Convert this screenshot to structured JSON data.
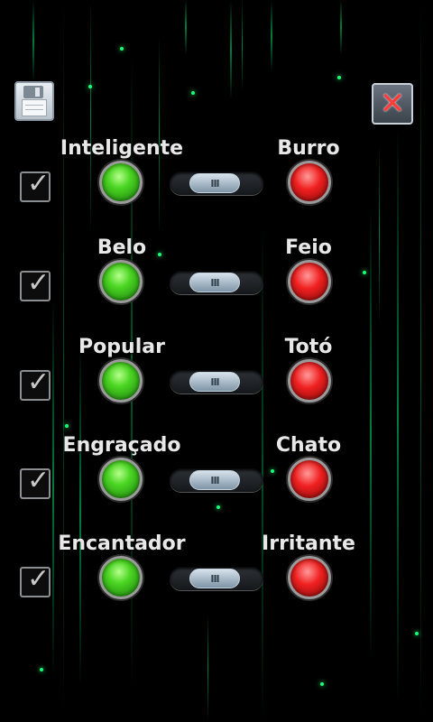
{
  "toolbar": {
    "save_icon": "floppy-disk-icon",
    "close_icon": "close-icon",
    "close_glyph": "✕"
  },
  "rows": [
    {
      "positive": "Inteligente",
      "negative": "Burro",
      "checked": true
    },
    {
      "positive": "Belo",
      "negative": "Feio",
      "checked": true
    },
    {
      "positive": "Popular",
      "negative": "Totó",
      "checked": true
    },
    {
      "positive": "Engraçado",
      "negative": "Chato",
      "checked": true
    },
    {
      "positive": "Encantador",
      "negative": "Irritante",
      "checked": true
    }
  ],
  "glyphs": {
    "check": "✓",
    "grip": "III"
  },
  "colors": {
    "background": "#000000",
    "matrix_green": "#1bff7a",
    "positive": "#3fcf22",
    "negative": "#e81c1c"
  }
}
